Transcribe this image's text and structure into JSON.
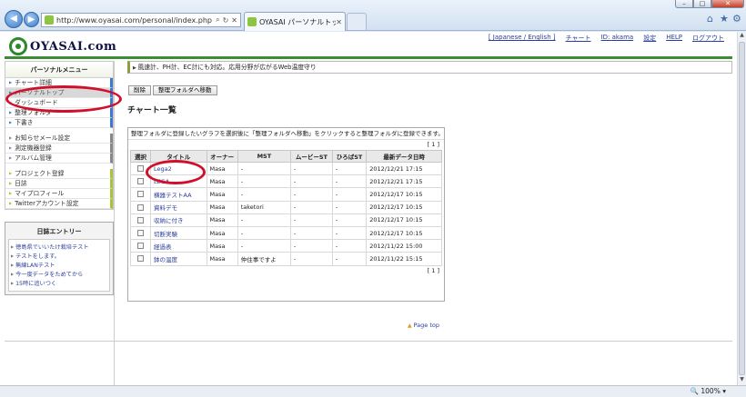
{
  "browser": {
    "url": "http://www.oyasai.com/personal/index.php",
    "tab_title": "OYASAI パーソナルトップ",
    "window_controls": {
      "minimize": "–",
      "maximize": "□",
      "close": "✕"
    },
    "toolbar_icons": [
      "home-icon",
      "star-icon",
      "gear-icon"
    ],
    "zoom": "100%"
  },
  "header": {
    "logo_text": "OYASAI.com",
    "topnav": [
      "[ Japanese / English ]",
      "チャート",
      "ID: akama",
      "設定",
      "HELP",
      "ログアウト"
    ]
  },
  "sidebar": {
    "menu_title": "パーソナルメニュー",
    "group1": [
      "チャート詳細",
      "パーソナルトップ",
      "ダッシュボード",
      "整理フォルダ",
      "下書き"
    ],
    "group2": [
      "お知らせメール設定",
      "測定機器登録",
      "アルバム管理"
    ],
    "group3": [
      "プロジェクト登録",
      "日誌",
      "マイプロフィール",
      "Twitterアカウント設定"
    ]
  },
  "diary": {
    "title": "日誌エントリー",
    "entries": [
      "徳島県でいいたけ栽培テスト",
      "テストをします。",
      "無線LANテスト",
      "今一度データをためてから",
      "15時に追いつく"
    ]
  },
  "main": {
    "banner": "風速計、PH計、EC計にも対応。応用分野が広がるWeb温度守り",
    "delete_button": "削除",
    "move_button": "整理フォルダへ移動",
    "section_title": "チャート一覧",
    "instructions": "整理フォルダに登録したいグラフを選択後に「整理フォルダへ移動」をクリックすると整理フォルダに登録できます。",
    "pager": "[ 1 ]",
    "columns": [
      "選択",
      "タイトル",
      "オーナー",
      "MST",
      "ムービーST",
      "ひろばST",
      "最新データ日時"
    ],
    "rows": [
      [
        "Lega2",
        "Masa",
        "-",
        "-",
        "-",
        "2012/12/21 17:15"
      ],
      [
        "LEGA",
        "Masa",
        "-",
        "-",
        "-",
        "2012/12/21 17:15"
      ],
      [
        "横器テストAA",
        "Masa",
        "-",
        "-",
        "-",
        "2012/12/17 10:15"
      ],
      [
        "資料デモ",
        "Masa",
        "taketori",
        "-",
        "-",
        "2012/12/17 10:15"
      ],
      [
        "収納に付き",
        "Masa",
        "-",
        "-",
        "-",
        "2012/12/17 10:15"
      ],
      [
        "切断実験",
        "Masa",
        "-",
        "-",
        "-",
        "2012/12/17 10:15"
      ],
      [
        "経過表",
        "Masa",
        "-",
        "-",
        "-",
        "2012/11/22 15:00"
      ],
      [
        "鉢の温度",
        "Masa",
        "仲住事ですよ",
        "-",
        "-",
        "2012/11/22 15:15"
      ]
    ],
    "page_top": "Page top"
  }
}
